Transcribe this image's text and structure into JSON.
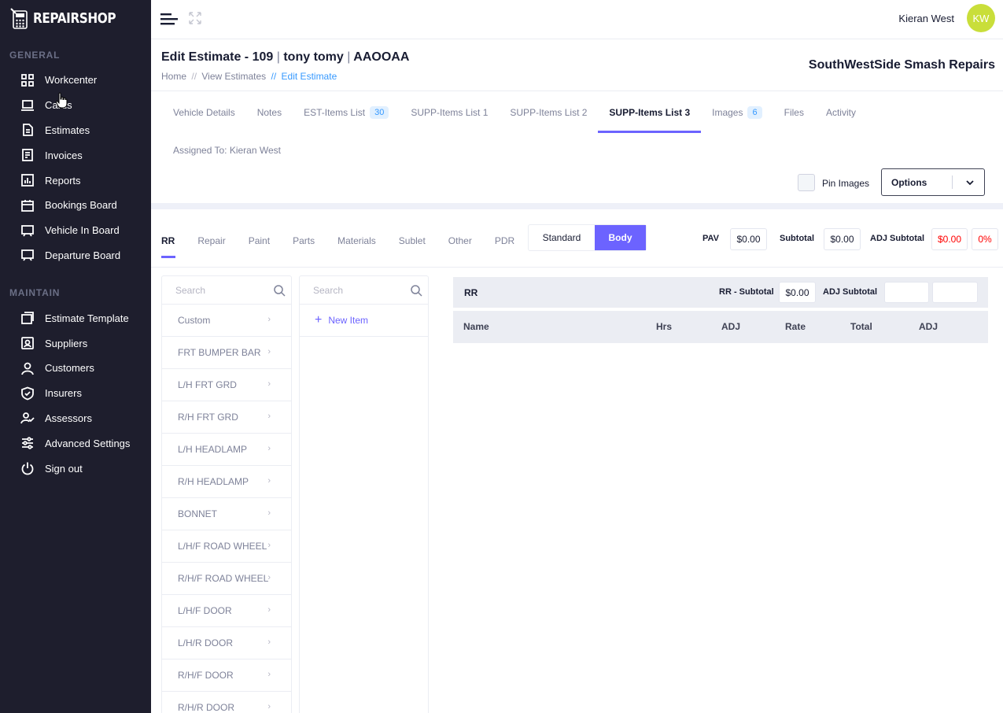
{
  "sidebar": {
    "logo_text": "REPAIRSHOP",
    "general_title": "GENERAL",
    "maintain_title": "MAINTAIN",
    "general_items": [
      {
        "label": "Workcenter",
        "icon": "grid-icon"
      },
      {
        "label": "Cards",
        "icon": "laptop-icon"
      },
      {
        "label": "Estimates",
        "icon": "document-icon"
      },
      {
        "label": "Invoices",
        "icon": "invoice-icon"
      },
      {
        "label": "Reports",
        "icon": "chart-icon"
      },
      {
        "label": "Bookings Board",
        "icon": "calendar-icon"
      },
      {
        "label": "Vehicle In Board",
        "icon": "board-icon"
      },
      {
        "label": "Departure Board",
        "icon": "board-icon"
      }
    ],
    "maintain_items": [
      {
        "label": "Estimate Template",
        "icon": "template-icon"
      },
      {
        "label": "Suppliers",
        "icon": "contact-icon"
      },
      {
        "label": "Customers",
        "icon": "user-icon"
      },
      {
        "label": "Insurers",
        "icon": "shield-icon"
      },
      {
        "label": "Assessors",
        "icon": "user-check-icon"
      },
      {
        "label": "Advanced Settings",
        "icon": "sliders-icon"
      },
      {
        "label": "Sign out",
        "icon": "power-icon"
      }
    ]
  },
  "header": {
    "user_name": "Kieran West",
    "avatar_initials": "KW",
    "avatar_color": "#c9de3a"
  },
  "subheader": {
    "title_prefix": "Edit Estimate - 109",
    "title_customer": "tony tomy",
    "title_plate": "AAOOAA",
    "breadcrumb": [
      "Home",
      "View Estimates",
      "Edit Estimate"
    ],
    "company": "SouthWestSide Smash Repairs"
  },
  "tabs": [
    {
      "label": "Vehicle Details"
    },
    {
      "label": "Notes"
    },
    {
      "label": "EST-Items List",
      "badge": "30"
    },
    {
      "label": "SUPP-Items List 1"
    },
    {
      "label": "SUPP-Items List 2"
    },
    {
      "label": "SUPP-Items List 3",
      "active": true
    },
    {
      "label": "Images",
      "badge": "6"
    },
    {
      "label": "Files"
    },
    {
      "label": "Activity"
    }
  ],
  "assigned_to": "Assigned To: Kieran West",
  "pin_images_label": "Pin Images",
  "options_label": "Options",
  "subtabs": [
    "RR",
    "Repair",
    "Paint",
    "Parts",
    "Materials",
    "Sublet",
    "Other",
    "PDR"
  ],
  "toggle": {
    "standard": "Standard",
    "body": "Body",
    "selected": "Body"
  },
  "summary": {
    "pav_label": "PAV",
    "pav_value": "$0.00",
    "subtotal_label": "Subtotal",
    "subtotal_value": "$0.00",
    "adj_subtotal_label": "ADJ Subtotal",
    "adj_subtotal_value": "$0.00",
    "adj_percent": "0%"
  },
  "search_placeholder": "Search",
  "categories": [
    "Custom",
    "FRT BUMPER BAR",
    "L/H FRT GRD",
    "R/H FRT GRD",
    "L/H HEADLAMP",
    "R/H HEADLAMP",
    "BONNET",
    "L/H/F ROAD WHEEL",
    "R/H/F ROAD WHEEL",
    "L/H/F DOOR",
    "L/H/R DOOR",
    "R/H/F DOOR",
    "R/H/R DOOR"
  ],
  "new_item_label": "New Item",
  "rr_panel": {
    "title": "RR",
    "subtotal_label": "RR - Subtotal",
    "subtotal_value": "$0.00",
    "adj_subtotal_label": "ADJ Subtotal",
    "adj_value_1": "",
    "adj_value_2": ""
  },
  "table_columns": [
    "Name",
    "Hrs",
    "ADJ",
    "Rate",
    "Total",
    "ADJ"
  ],
  "colors": {
    "accent": "#6c63ff",
    "sidebar_bg": "#1e1e2d",
    "danger": "#ff0000"
  }
}
